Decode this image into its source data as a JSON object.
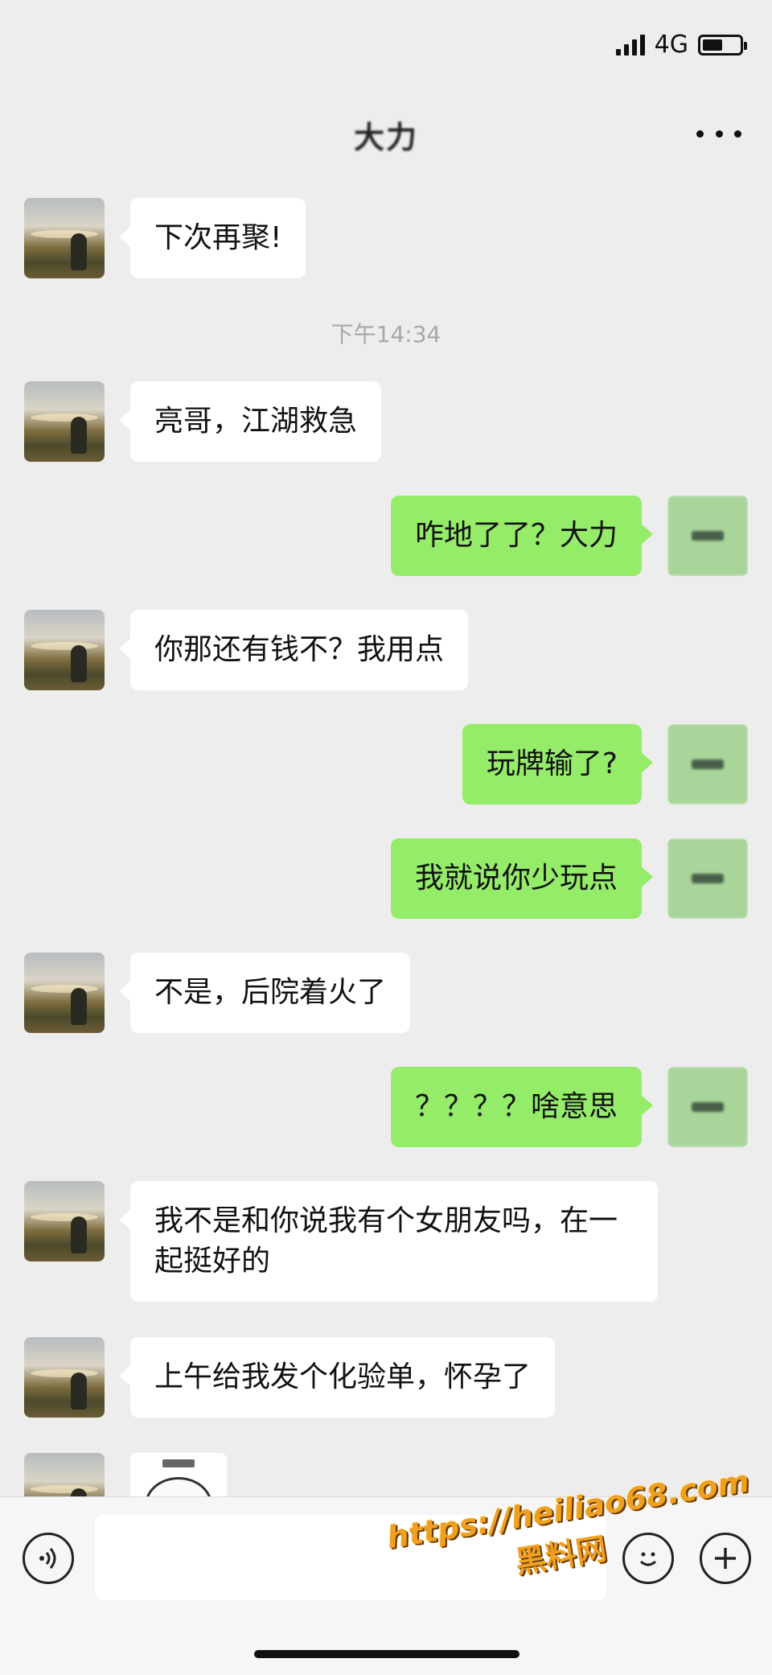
{
  "status_bar": {
    "network": "4G",
    "battery_level": 0.55
  },
  "header": {
    "title": "大力",
    "more_icon": "more-dots-icon"
  },
  "messages": [
    {
      "side": "left",
      "text": "下次再聚!"
    },
    {
      "type": "time",
      "text": "下午14:34"
    },
    {
      "side": "left",
      "text": "亮哥，江湖救急"
    },
    {
      "side": "right",
      "text": "咋地了了？大力"
    },
    {
      "side": "left",
      "text": "你那还有钱不？我用点"
    },
    {
      "side": "right",
      "text": "玩牌输了?"
    },
    {
      "side": "right",
      "text": "我就说你少玩点"
    },
    {
      "side": "left",
      "text": "不是，后院着火了"
    },
    {
      "side": "right",
      "text": "？？？？啥意思"
    },
    {
      "side": "left",
      "text": "我不是和你说我有个女朋友吗，在一起挺好的"
    },
    {
      "side": "left",
      "text": "上午给我发个化验单，怀孕了"
    },
    {
      "side": "left",
      "type": "sticker",
      "icon": "face-sticker-icon"
    }
  ],
  "input_bar": {
    "voice_icon": "voice-icon",
    "emoji_icon": "emoji-icon",
    "plus_icon": "plus-icon",
    "text_value": ""
  },
  "watermark": {
    "url": "https://heiliao68.com",
    "name": "黑料网"
  },
  "colors": {
    "background": "#ededed",
    "incoming_bubble": "#ffffff",
    "outgoing_bubble": "#95ec69",
    "timestamp": "#a8a8a8"
  }
}
